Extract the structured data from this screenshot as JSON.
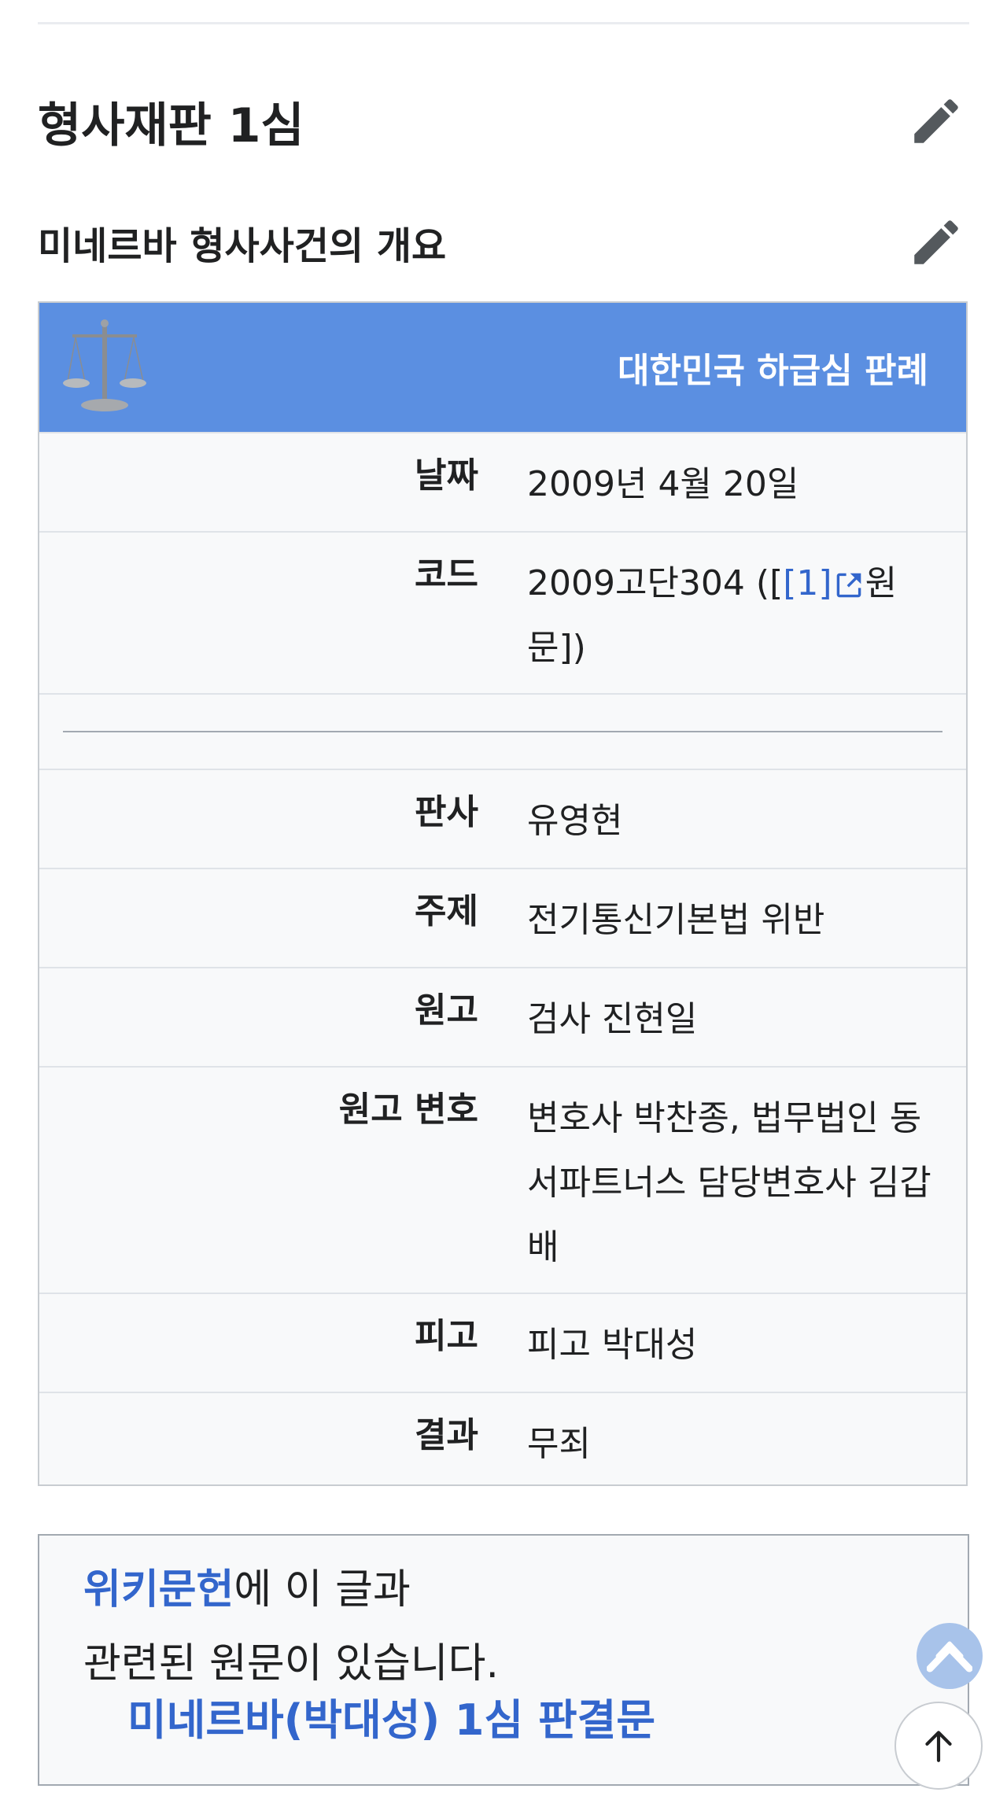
{
  "section": {
    "title": "형사재판 1심",
    "subsection_title": "미네르바 형사사건의 개요"
  },
  "infobox": {
    "header": "대한민국 하급심 판례",
    "rows": [
      {
        "label": "날짜",
        "value": "2009년 4월 20일"
      },
      {
        "label": "코드",
        "value_prefix": "2009고단304 ([",
        "link_text": "[1]",
        "value_suffix": "원문])"
      },
      {
        "label": "판사",
        "value": "유영현"
      },
      {
        "label": "주제",
        "value": "전기통신기본법 위반"
      },
      {
        "label": "원고",
        "value": "검사 진현일"
      },
      {
        "label": "원고 변호",
        "value": "변호사 박찬종, 법무법인 동서파트너스 담당변호사 김갑배"
      },
      {
        "label": "피고",
        "value": "피고 박대성"
      },
      {
        "label": "결과",
        "value": "무죄"
      }
    ]
  },
  "wikisource": {
    "link": "위키문헌",
    "text_after_link": "에 이 글과",
    "line2": "관련된 원문이 있습니다.",
    "doc_link": "미네르바(박대성) 1심 판결문"
  },
  "icons": {
    "edit": "pencil-icon",
    "scale": "scales-of-justice-icon",
    "external": "external-link-icon",
    "wikisource": "wikisource-icon",
    "scroll_top": "arrow-up-icon"
  },
  "colors": {
    "infobox_header": "#5b8fe1",
    "link": "#3366cc",
    "infobox_bg": "#f8f9fa"
  }
}
